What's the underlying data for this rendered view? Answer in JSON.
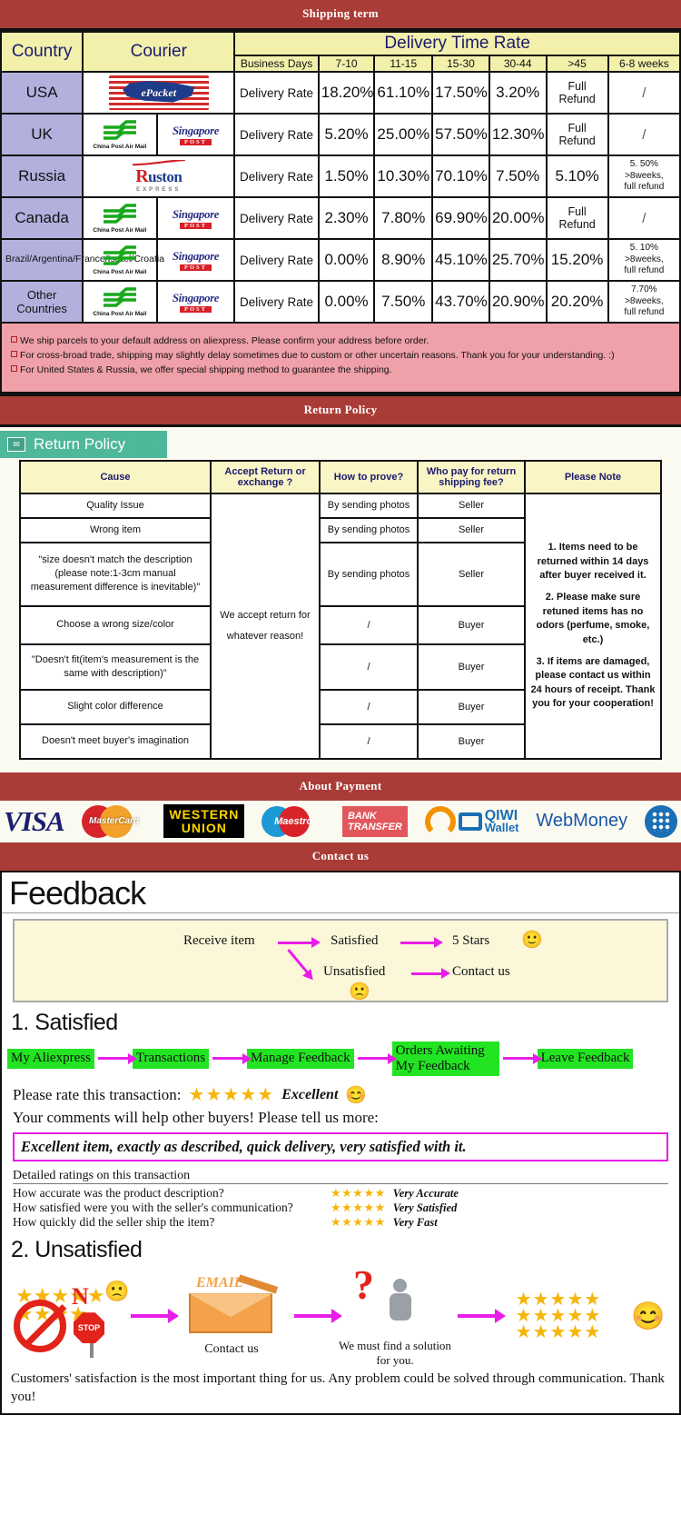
{
  "banners": {
    "shipping": "Shipping term",
    "return": "Return Policy",
    "payment": "About Payment",
    "contact": "Contact us"
  },
  "shipping": {
    "headers": {
      "country": "Country",
      "courier": "Courier",
      "delivery_time_rate": "Delivery Time Rate",
      "business_days": "Business Days",
      "cols": [
        "7-10",
        "11-15",
        "15-30",
        "30-44",
        ">45",
        "6-8 weeks"
      ]
    },
    "rate_label": "Delivery Rate",
    "rows": [
      {
        "country": "USA",
        "couriers": [
          "epacket"
        ],
        "values": [
          "18.20%",
          "61.10%",
          "17.50%",
          "3.20%",
          "Full Refund",
          "/"
        ]
      },
      {
        "country": "UK",
        "couriers": [
          "china-post-air-mail",
          "singapore-post"
        ],
        "values": [
          "5.20%",
          "25.00%",
          "57.50%",
          "12.30%",
          "Full Refund",
          "/"
        ]
      },
      {
        "country": "Russia",
        "couriers": [
          "ruston-express"
        ],
        "values": [
          "1.50%",
          "10.30%",
          "70.10%",
          "7.50%",
          "5.10%",
          "5. 50%\n>8weeks,\nfull refund"
        ]
      },
      {
        "country": "Canada",
        "couriers": [
          "china-post-air-mail",
          "singapore-post"
        ],
        "values": [
          "2.30%",
          "7.80%",
          "69.90%",
          "20.00%",
          "Full Refund",
          "/"
        ]
      },
      {
        "country": "Brazil/Argentina/France/Israel/Croatia",
        "couriers": [
          "china-post-air-mail",
          "singapore-post"
        ],
        "values": [
          "0.00%",
          "8.90%",
          "45.10%",
          "25.70%",
          "15.20%",
          "5. 10%\n>8weeks,\nfull refund"
        ]
      },
      {
        "country": "Other Countries",
        "couriers": [
          "china-post-air-mail",
          "singapore-post"
        ],
        "values": [
          "0.00%",
          "7.50%",
          "43.70%",
          "20.90%",
          "20.20%",
          "7.70%\n>8weeks,\nfull refund"
        ]
      }
    ],
    "notes": [
      "We ship parcels to your default address on aliexpress. Please confirm your address before order.",
      "For cross-broad trade, shipping may slightly delay sometimes due to custom or other uncertain reasons. Thank you for your understanding. :)",
      "For United States & Russia, we offer special shipping method to guarantee the shipping."
    ],
    "logos": {
      "epacket": "ePacket",
      "china_post": "China Post Air Mail",
      "singapore_post": "Singapore",
      "singapore_post_tag": "POST",
      "ruston_r": "R",
      "ruston_rest": "uston",
      "ruston_sub": "EXPRESS"
    }
  },
  "return_policy": {
    "ribbon_label": "Return Policy",
    "headers": [
      "Cause",
      "Accept Return or exchange ?",
      "How to prove?",
      "Who pay for return shipping fee?",
      "Please Note"
    ],
    "accept_text": "We accept return for whatever reason!",
    "rows": [
      {
        "cause": "Quality Issue",
        "prove": "By sending photos",
        "who": "Seller"
      },
      {
        "cause": "Wrong item",
        "prove": "By sending photos",
        "who": "Seller"
      },
      {
        "cause": "\"size doesn't match the description (please note:1-3cm manual measurement difference is inevitable)\"",
        "prove": "By sending photos",
        "who": "Seller"
      },
      {
        "cause": "Choose a wrong size/color",
        "prove": "/",
        "who": "Buyer"
      },
      {
        "cause": "\"Doesn't fit(item's measurement is the same with description)\"",
        "prove": "/",
        "who": "Buyer"
      },
      {
        "cause": "Slight color difference",
        "prove": "/",
        "who": "Buyer"
      },
      {
        "cause": "Doesn't meet buyer's imagination",
        "prove": "/",
        "who": "Buyer"
      }
    ],
    "notes": [
      "1. Items need to be returned within 14 days after buyer received it.",
      "2. Please make sure retuned items has no odors (perfume, smoke, etc.)",
      "3. If items are damaged, please contact us within 24 hours of receipt. Thank you for your cooperation!"
    ]
  },
  "payment": {
    "methods": [
      {
        "name": "visa",
        "label": "VISA"
      },
      {
        "name": "mastercard",
        "label": "MasterCard"
      },
      {
        "name": "western-union",
        "label_top": "WESTERN",
        "label_bottom": "UNION"
      },
      {
        "name": "maestro",
        "label": "Maestro"
      },
      {
        "name": "bank-transfer",
        "label_top": "BANK",
        "label_bottom": "TRANSFER"
      },
      {
        "name": "qiwi-wallet",
        "label_top": "QIWI",
        "label_bottom": "Wallet"
      },
      {
        "name": "webmoney",
        "label": "WebMoney"
      }
    ]
  },
  "feedback": {
    "title": "Feedback",
    "flow": {
      "receive": "Receive item",
      "satisfied": "Satisfied",
      "five_stars": "5 Stars",
      "unsatisfied": "Unsatisfied",
      "contact": "Contact us",
      "happy_emoji": "🙂",
      "sad_emoji": "🙁"
    },
    "satisfied": {
      "heading": "1. Satisfied",
      "steps": [
        "My Aliexpress",
        "Transactions",
        "Manage Feedback",
        "Orders Awaiting My Feedback",
        "Leave Feedback"
      ],
      "rate_prompt": "Please rate this transaction:",
      "stars": "★★★★★",
      "rating_word": "Excellent",
      "smile": "😊",
      "comment_prompt": "Your comments will help other buyers! Please tell us more:",
      "comment_text": "Excellent item, exactly as described, quick delivery, very satisfied with it.",
      "detail_header": "Detailed ratings on this transaction",
      "details": [
        {
          "question": "How accurate was the product description?",
          "stars": "★★★★★",
          "value": "Very Accurate"
        },
        {
          "question": "How satisfied were you with the seller's communication?",
          "stars": "★★★★★",
          "value": "Very Satisfied"
        },
        {
          "question": "How quickly did the seller ship the item?",
          "stars": "★★★★★",
          "value": "Very Fast"
        }
      ]
    },
    "unsatisfied": {
      "heading": "2. Unsatisfied",
      "no_label": "N",
      "stop_label": "STOP",
      "sad_emoji": "🙁",
      "email_label": "EMAIL",
      "contact_caption": "Contact us",
      "solution_caption": "We must find a solution for you.",
      "stars_block": "★★★★★\n★★★★★\n★★★★★",
      "final_smile": "😊",
      "closing": "Customers' satisfaction is the most important thing for us. Any problem could be solved through communication. Thank you!"
    }
  }
}
